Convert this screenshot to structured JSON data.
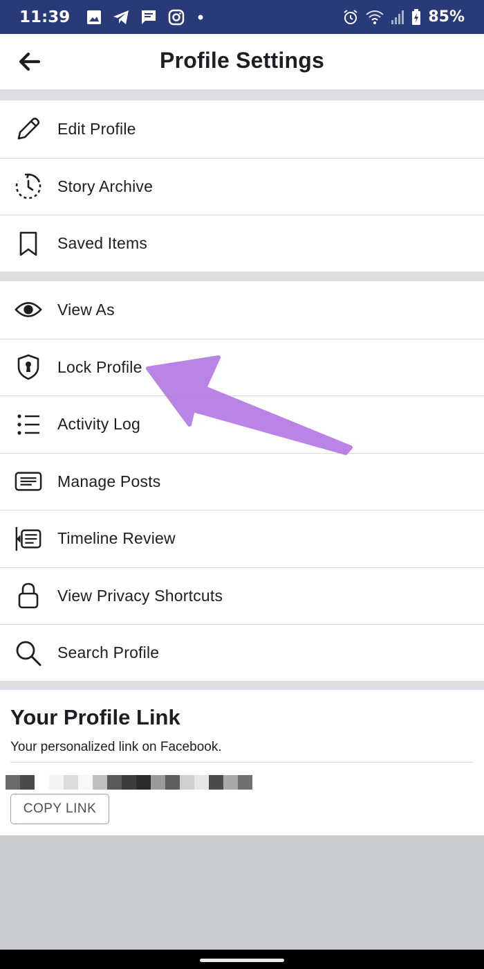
{
  "status_bar": {
    "time": "11:39",
    "battery_percent": "85%",
    "icons_left": [
      "gallery-icon",
      "telegram-icon",
      "message-icon",
      "instagram-icon",
      "dot-icon"
    ],
    "icons_right": [
      "alarm-icon",
      "wifi-icon",
      "signal-icon",
      "battery-icon"
    ]
  },
  "header": {
    "title": "Profile Settings",
    "back_icon": "arrow-left-icon"
  },
  "menu": {
    "group1": [
      {
        "label": "Edit Profile",
        "icon": "pencil-icon"
      },
      {
        "label": "Story Archive",
        "icon": "clock-archive-icon"
      },
      {
        "label": "Saved Items",
        "icon": "bookmark-icon"
      }
    ],
    "group2": [
      {
        "label": "View As",
        "icon": "eye-icon"
      },
      {
        "label": "Lock Profile",
        "icon": "shield-lock-icon"
      },
      {
        "label": "Activity Log",
        "icon": "list-icon"
      },
      {
        "label": "Manage Posts",
        "icon": "posts-icon"
      },
      {
        "label": "Timeline Review",
        "icon": "timeline-review-icon"
      },
      {
        "label": "View Privacy Shortcuts",
        "icon": "padlock-icon"
      },
      {
        "label": "Search Profile",
        "icon": "search-icon"
      }
    ]
  },
  "profile_link": {
    "title": "Your Profile Link",
    "subtitle": "Your personalized link on Facebook.",
    "copy_button": "COPY LINK"
  },
  "colors": {
    "status_bar": "#283a78",
    "separator": "#dadde1",
    "arrow": "#b87fe6",
    "background": "#c9ccd1"
  }
}
